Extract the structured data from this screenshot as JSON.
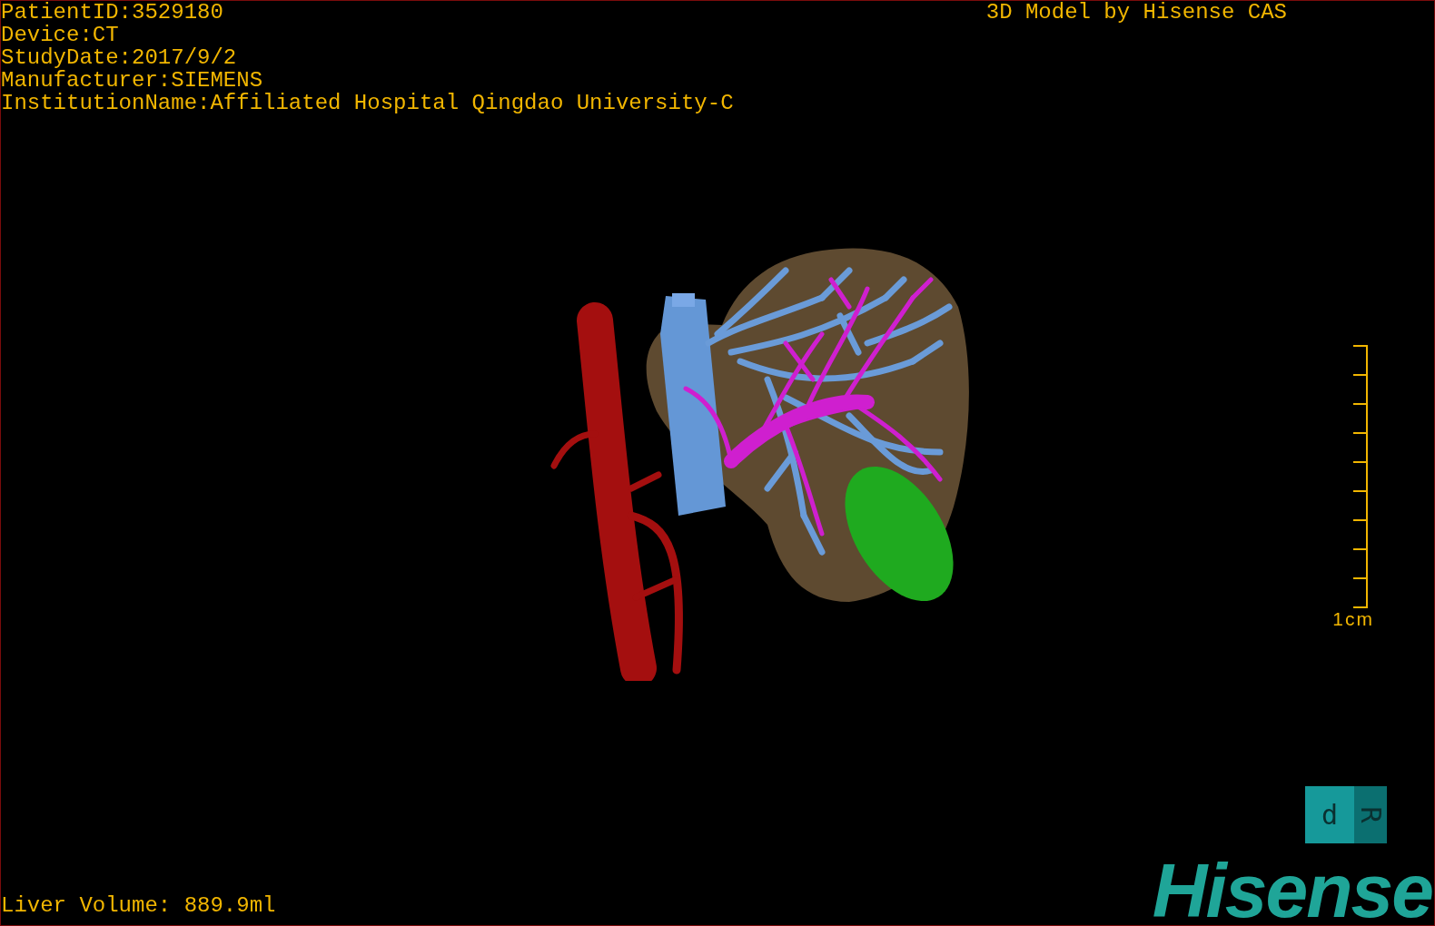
{
  "info_lines": [
    "PatientID:3529180",
    "Device:CT",
    "StudyDate:2017/9/2",
    "Manufacturer:SIEMENS",
    "InstitutionName:Affiliated Hospital Qingdao University-C"
  ],
  "title": "3D Model by Hisense CAS",
  "scale_bar": {
    "label": "1cm"
  },
  "liver_volume": "Liver Volume: 889.9ml",
  "orientation_cube": {
    "faces": [
      "d",
      "R"
    ]
  },
  "logo": "Hisense"
}
